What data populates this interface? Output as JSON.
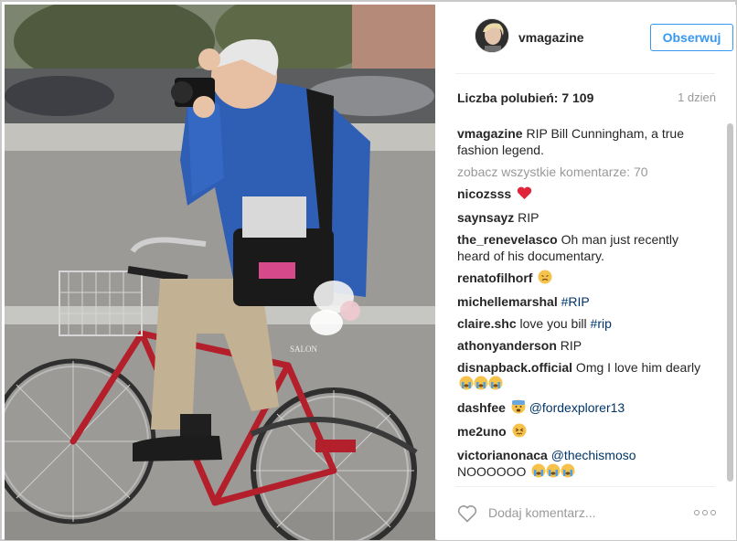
{
  "post": {
    "username": "vmagazine",
    "follow_label": "Obserwuj",
    "likes_text": "Liczba polubień: 7 109",
    "time_text": "1 dzień",
    "caption": {
      "user": "vmagazine",
      "text": " RIP Bill Cunningham, a true fashion legend."
    },
    "view_all_text": "zobacz wszystkie komentarze: 70",
    "comments": [
      {
        "user": "nicozsss",
        "text": "",
        "emoji": "heart"
      },
      {
        "user": "saynsayz",
        "text": " RIP"
      },
      {
        "user": "the_renevelasco",
        "text": " Oh man just recently heard of his documentary."
      },
      {
        "user": "renatofilhorf",
        "text": "",
        "emoji": "sad"
      },
      {
        "user": "michellemarshal",
        "text": "",
        "tag": " #RIP"
      },
      {
        "user": "claire.shc",
        "text": " love you bill ",
        "tag": "#rip"
      },
      {
        "user": "athonyanderson",
        "text": " RIP"
      },
      {
        "user": "disnapback.official",
        "text": " Omg I love him dearly",
        "emoji": "cry3"
      },
      {
        "user": "dashfee",
        "text": "",
        "emoji": "fear",
        "tag": "@fordexplorer13"
      },
      {
        "user": "me2uno",
        "text": "",
        "emoji": "sad2"
      },
      {
        "user": "victorianonaca",
        "text": "",
        "tag": " @thechismoso",
        "line2": "NOOOOOO",
        "emoji2": "cry3"
      }
    ],
    "comment_placeholder": "Dodaj komentarz...",
    "icons": {
      "like": "heart-outline-icon",
      "more": "more-options-icon"
    },
    "colors": {
      "accent": "#3897f0",
      "link": "#003569",
      "muted": "#999999"
    }
  }
}
